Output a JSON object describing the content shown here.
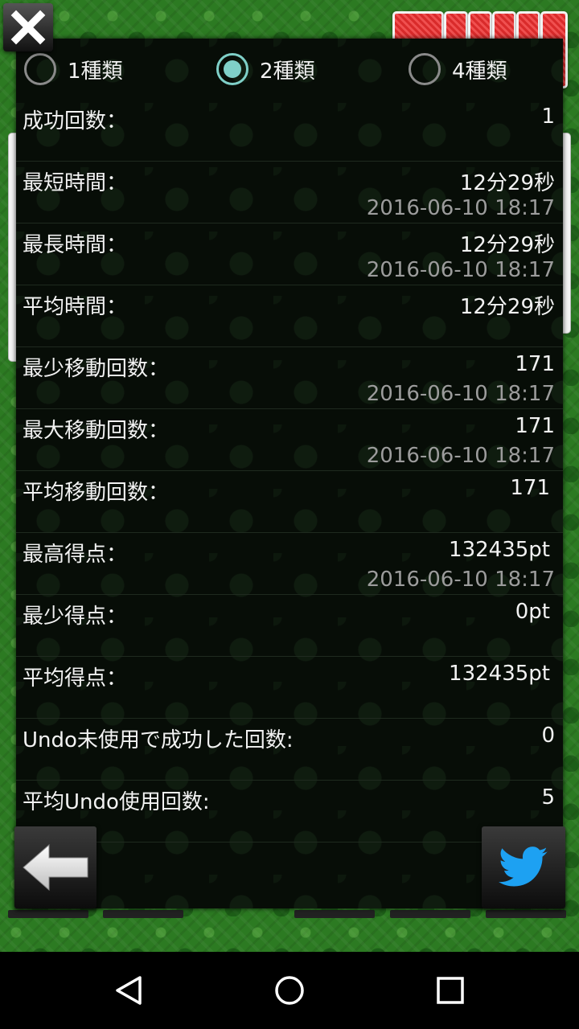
{
  "window": {
    "close_icon": "close-x-icon"
  },
  "colors": {
    "accent": "#7fd0c8",
    "dialog_bg": "#070d07",
    "felt": "#2c7a22",
    "twitter_blue": "#1da1f2"
  },
  "filter": {
    "options": [
      {
        "label": "1種類",
        "checked": false
      },
      {
        "label": "2種類",
        "checked": true
      },
      {
        "label": "4種類",
        "checked": false
      }
    ]
  },
  "stats": [
    {
      "label": "成功回数：",
      "value": "1",
      "date": ""
    },
    {
      "label": "最短時間：",
      "value": "12分29秒",
      "date": "2016-06-10 18:17"
    },
    {
      "label": "最長時間：",
      "value": "12分29秒",
      "date": "2016-06-10 18:17"
    },
    {
      "label": "平均時間：",
      "value": "12分29秒",
      "date": ""
    },
    {
      "label": "最少移動回数：",
      "value": "171",
      "date": "2016-06-10 18:17"
    },
    {
      "label": "最大移動回数：",
      "value": "171",
      "date": "2016-06-10 18:17"
    },
    {
      "label": "平均移動回数：",
      "value": "171",
      "date": ""
    },
    {
      "label": "最高得点：",
      "value": "132435pt",
      "date": "2016-06-10 18:17"
    },
    {
      "label": "最少得点：",
      "value": "0pt",
      "date": ""
    },
    {
      "label": "平均得点：",
      "value": "132435pt",
      "date": ""
    },
    {
      "label": "Undo未使用で成功した回数:",
      "value": "0",
      "date": ""
    },
    {
      "label": "平均Undo使用回数:",
      "value": "5",
      "date": ""
    }
  ],
  "bottom": {
    "back_icon": "back-arrow-icon",
    "share_icon": "twitter-bird-icon"
  },
  "navbar": {
    "back_icon": "nav-back-icon",
    "home_icon": "nav-home-icon",
    "recents_icon": "nav-recents-icon"
  }
}
